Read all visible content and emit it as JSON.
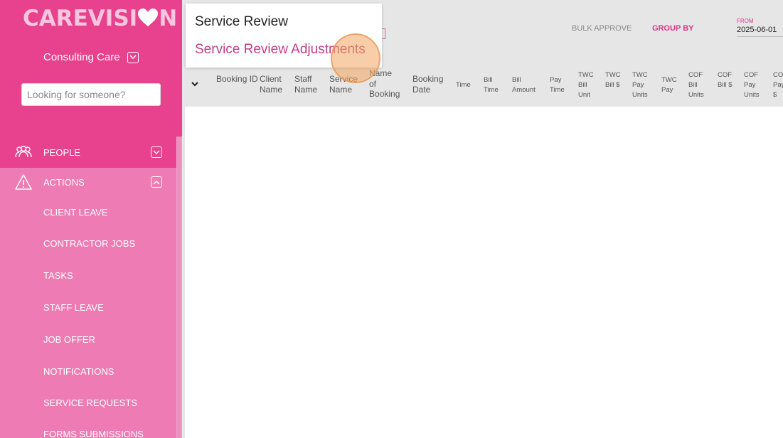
{
  "brand": {
    "logo_prefix": "CAREVISI",
    "logo_suffix": "N",
    "logo_color": "#f8c6df",
    "accent": "#e8418e"
  },
  "sidebar": {
    "org_name": "Consulting Care",
    "search_placeholder": "Looking for someone?",
    "nav": [
      {
        "label": "PEOPLE",
        "icon": "people-icon",
        "expanded": false
      },
      {
        "label": "ACTIONS",
        "icon": "warning-icon",
        "expanded": true
      }
    ],
    "action_items": [
      "CLIENT LEAVE",
      "CONTRACTOR JOBS",
      "TASKS",
      "STAFF LEAVE",
      "JOB OFFER",
      "NOTIFICATIONS",
      "SERVICE REQUESTS",
      "FORMS SUBMISSIONS"
    ]
  },
  "toolbar": {
    "bulk_approve": "BULK APPROVE",
    "group_by": "GROUP BY",
    "from_label": "FROM",
    "from_value": "2025-06-01"
  },
  "dropdown": {
    "items": [
      "Service Review",
      "Service Review Adjustments"
    ]
  },
  "table": {
    "columns": [
      "Booking ID",
      "Client Name",
      "Staff Name",
      "Service Name",
      "Name of Booking",
      "Booking Date",
      "Time",
      "Bill Time",
      "Bill Amount",
      "Pay Time",
      "TWC Bill Unit",
      "TWC Bill $",
      "TWC Pay Units",
      "TWC Pay",
      "COF Bill Units",
      "COF Bill $",
      "COF Pay Units",
      "COF Pay $"
    ]
  }
}
